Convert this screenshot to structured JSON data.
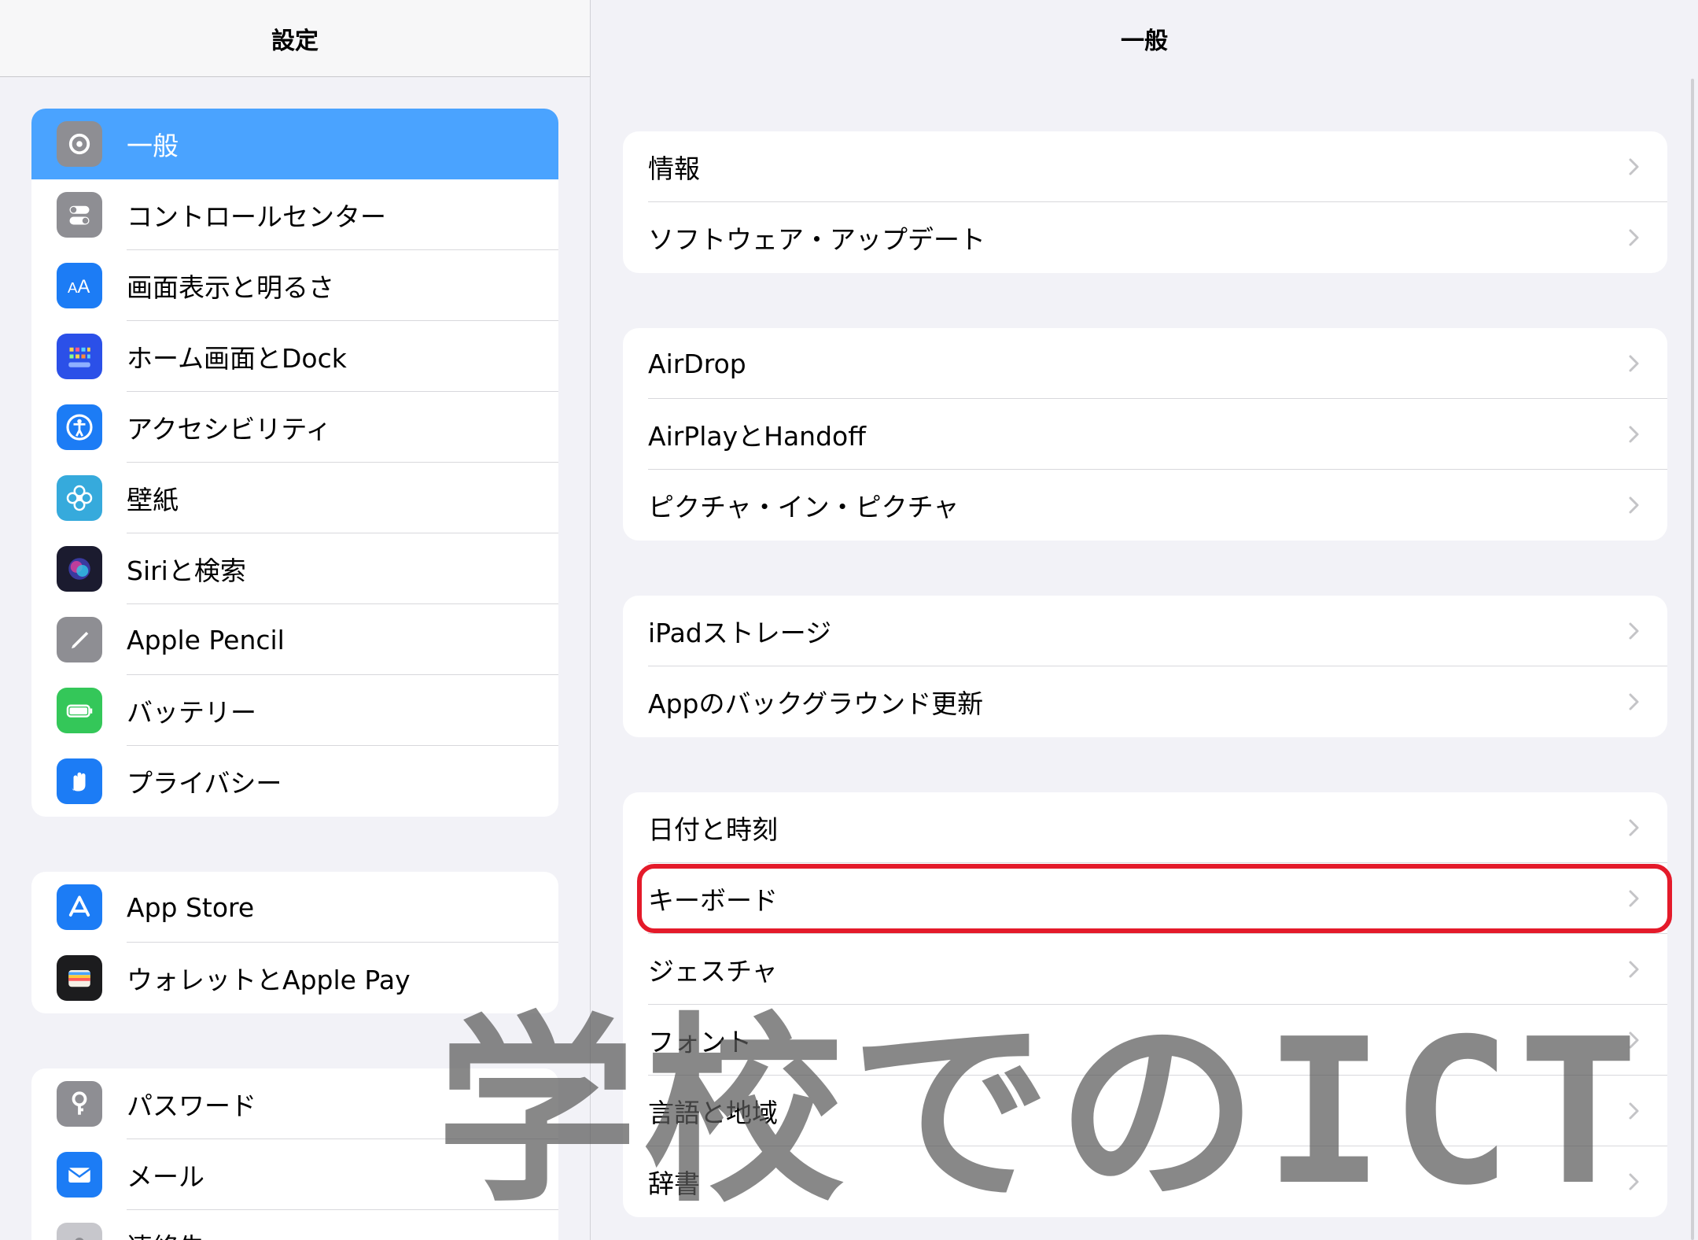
{
  "sidebar": {
    "title": "設定",
    "groups": [
      [
        {
          "label": "一般",
          "icon": "gear-icon",
          "color": "#8e8e93",
          "selected": true
        },
        {
          "label": "コントロールセンター",
          "icon": "toggles-icon",
          "color": "#8e8e93"
        },
        {
          "label": "画面表示と明るさ",
          "icon": "text-size-icon",
          "color": "#1c7cf5"
        },
        {
          "label": "ホーム画面とDock",
          "icon": "home-grid-icon",
          "color": "#2b50e8"
        },
        {
          "label": "アクセシビリティ",
          "icon": "accessibility-icon",
          "color": "#1c7cf5"
        },
        {
          "label": "壁紙",
          "icon": "flower-icon",
          "color": "#36aadc"
        },
        {
          "label": "Siriと検索",
          "icon": "siri-icon",
          "color": "#1b1b2f"
        },
        {
          "label": "Apple Pencil",
          "icon": "pencil-icon",
          "color": "#8e8e93"
        },
        {
          "label": "バッテリー",
          "icon": "battery-icon",
          "color": "#34c759"
        },
        {
          "label": "プライバシー",
          "icon": "hand-icon",
          "color": "#1c7cf5"
        }
      ],
      [
        {
          "label": "App Store",
          "icon": "app-store-icon",
          "color": "#1c7cf5"
        },
        {
          "label": "ウォレットとApple Pay",
          "icon": "wallet-icon",
          "color": "#1c1c1e"
        }
      ],
      [
        {
          "label": "パスワード",
          "icon": "key-icon",
          "color": "#8e8e93"
        },
        {
          "label": "メール",
          "icon": "mail-icon",
          "color": "#1c7cf5"
        },
        {
          "label": "連絡先",
          "icon": "contacts-icon",
          "color": "#c7c7cc"
        }
      ]
    ]
  },
  "main": {
    "title": "一般",
    "groups": [
      [
        {
          "label": "情報"
        },
        {
          "label": "ソフトウェア・アップデート"
        }
      ],
      [
        {
          "label": "AirDrop"
        },
        {
          "label": "AirPlayとHandoff"
        },
        {
          "label": "ピクチャ・イン・ピクチャ"
        }
      ],
      [
        {
          "label": "iPadストレージ"
        },
        {
          "label": "Appのバックグラウンド更新"
        }
      ],
      [
        {
          "label": "日付と時刻"
        },
        {
          "label": "キーボード",
          "highlighted": true
        },
        {
          "label": "ジェスチャ"
        },
        {
          "label": "フォント"
        },
        {
          "label": "言語と地域"
        },
        {
          "label": "辞書"
        }
      ]
    ]
  },
  "watermark": "学校でのICT",
  "colors": {
    "selected_row": "#4aa3ff",
    "highlight": "#e41a2a",
    "background": "#f2f2f7"
  }
}
